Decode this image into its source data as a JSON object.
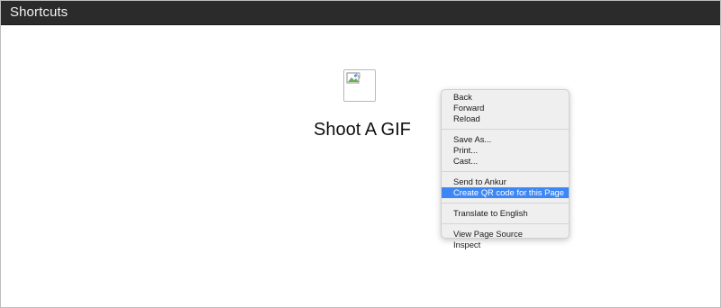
{
  "window": {
    "title": "Shortcuts"
  },
  "page": {
    "heading": "Shoot A GIF",
    "image_icon": "broken-image-icon"
  },
  "context_menu": {
    "groups": [
      [
        "Back",
        "Forward",
        "Reload"
      ],
      [
        "Save As...",
        "Print...",
        "Cast..."
      ],
      [
        "Send to Ankur",
        "Create QR code for this Page"
      ],
      [
        "Translate to English"
      ],
      [
        "View Page Source",
        "Inspect"
      ]
    ],
    "highlighted_item": "Create QR code for this Page",
    "highlight_color": "#3d87f5"
  },
  "colors": {
    "titlebar": "#2b2b2b",
    "titlebar_text": "#f2f2f2",
    "menu_background": "#efefef"
  }
}
